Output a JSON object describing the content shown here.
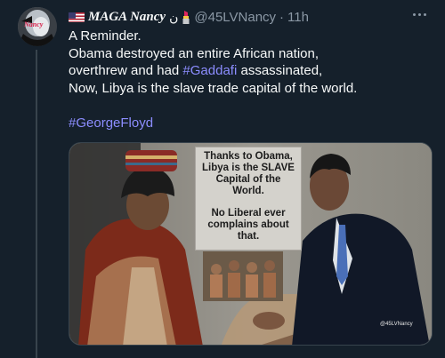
{
  "tweet": {
    "display_name": "MAGA Nancy",
    "name_extra": "ن",
    "handle": "@45LVNancy",
    "separator": "·",
    "time": "11h",
    "lines": [
      "A Reminder.",
      "Obama destroyed an entire African nation,",
      "overthrew and had ",
      "#Gaddafi",
      " assassinated,",
      "Now, Libya is the slave trade capital of the world."
    ],
    "hashtag": "#GeorgeFloyd",
    "avatar_text": "Nancy",
    "icons": {
      "flag": "us-flag-icon",
      "lipstick": "lipstick-icon",
      "more": "more-options-icon"
    },
    "colors": {
      "background": "#15202b",
      "link": "#8c8dff",
      "muted": "#8b98a5"
    }
  },
  "media": {
    "meme_lines_top": [
      "Thanks to Obama,",
      "Libya is the SLAVE",
      "Capital of the",
      "World."
    ],
    "meme_lines_bottom": [
      "No Liberal ever",
      "complains about",
      "that."
    ],
    "watermark": "@45LVNancy"
  }
}
